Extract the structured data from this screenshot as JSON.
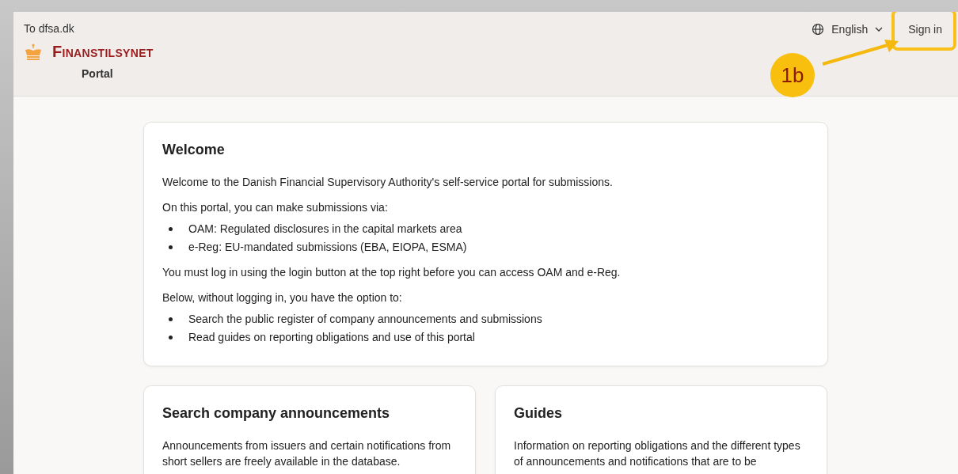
{
  "header": {
    "back_link": "To dfsa.dk",
    "logo": {
      "name": "Finanstilsynet",
      "subtitle": "Portal"
    },
    "language": "English",
    "sign_in": "Sign in"
  },
  "annotation": {
    "badge": "1b"
  },
  "welcome": {
    "title": "Welcome",
    "blocks": [
      {
        "kind": "paragraph",
        "text": "Welcome to the Danish Financial Supervisory Authority's self-service portal for submissions."
      },
      {
        "kind": "paragraph",
        "text": "On this portal, you can make submissions via:"
      },
      {
        "kind": "list",
        "items": [
          "OAM: Regulated disclosures in the capital markets area",
          "e-Reg: EU-mandated submissions (EBA, EIOPA, ESMA)"
        ]
      },
      {
        "kind": "paragraph",
        "text": "You must log in using the login button at the top right before you can access OAM and e-Reg."
      },
      {
        "kind": "paragraph",
        "text": "Below, without logging in, you have the option to:"
      },
      {
        "kind": "list",
        "items": [
          "Search the public register of company announcements and submissions",
          "Read guides on reporting obligations and use of this portal"
        ]
      }
    ]
  },
  "cards": [
    {
      "title": "Search company announcements",
      "text": "Announcements from issuers and certain notifications from short sellers are freely available in the database."
    },
    {
      "title": "Guides",
      "text": "Information on reporting obligations and the different types of announcements and notifications that are to be"
    }
  ]
}
